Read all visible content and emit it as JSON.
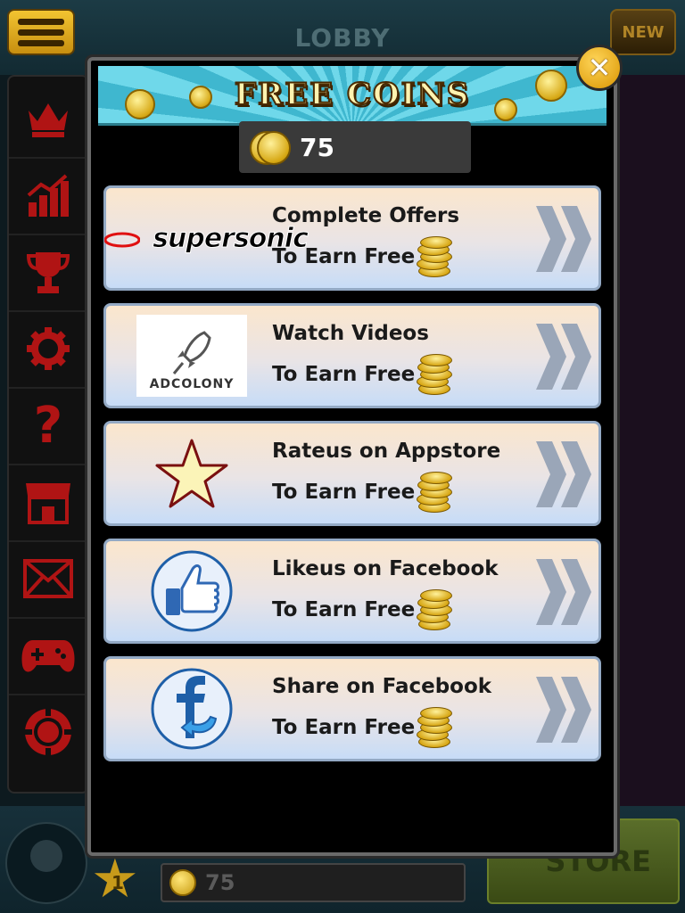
{
  "lobby": {
    "title": "LOBBY",
    "new_badge": "NEW",
    "level": "1",
    "coins": "75",
    "store_label": "STORE"
  },
  "sidebar": {
    "items": [
      {
        "icon": "crown-icon"
      },
      {
        "icon": "stats-icon"
      },
      {
        "icon": "trophy-icon"
      },
      {
        "icon": "gear-icon"
      },
      {
        "icon": "help-icon"
      },
      {
        "icon": "shop-icon"
      },
      {
        "icon": "mail-icon"
      },
      {
        "icon": "gamepad-icon"
      },
      {
        "icon": "poker-chip-icon"
      }
    ]
  },
  "modal": {
    "title": "FREE COINS",
    "balance": "75",
    "offers": [
      {
        "logo_text": "supersonic",
        "line1": "Complete Offers",
        "line2": "To Earn Free"
      },
      {
        "logo_text": "ADCOLONY",
        "line1": "Watch Videos",
        "line2": "To Earn Free"
      },
      {
        "logo_text": "",
        "line1": "Rateus on Appstore",
        "line2": "To Earn Free"
      },
      {
        "logo_text": "",
        "line1": "Likeus on Facebook",
        "line2": "To Earn Free"
      },
      {
        "logo_text": "",
        "line1": "Share on Facebook",
        "line2": "To Earn Free"
      }
    ]
  },
  "colors": {
    "gold": "#f2c431",
    "sidebar_icon": "#b01414",
    "offer_border": "#93a9c4",
    "header_cyan": "#4fc3d9"
  }
}
